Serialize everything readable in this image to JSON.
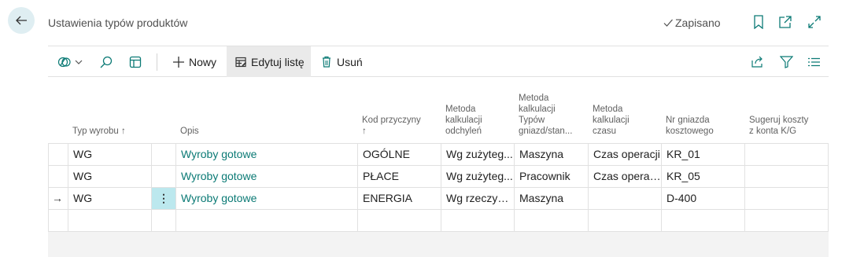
{
  "page": {
    "title": "Ustawienia typów produktów",
    "saved_label": "Zapisano"
  },
  "toolbar": {
    "new_label": "Nowy",
    "edit_list_label": "Edytuj listę",
    "delete_label": "Usuń"
  },
  "columns": {
    "product_type": "Typ wyrobu",
    "product_type_sort": "↑",
    "description": "Opis",
    "reason_code_line1": "Kod przyczyny",
    "reason_code_line2": "↑",
    "variance_line1": "Metoda",
    "variance_line2": "kalkulacji",
    "variance_line3": "odchyleń",
    "wc_line1": "Metoda",
    "wc_line2": "kalkulacji",
    "wc_line3": "Typów",
    "wc_line4": "gniazd/stan...",
    "time_line1": "Metoda",
    "time_line2": "kalkulacji",
    "time_line3": "czasu",
    "center_line1": "Nr gniazda",
    "center_line2": "kosztowego",
    "suggest_line1": "Sugeruj koszty",
    "suggest_line2": "z konta K/G"
  },
  "rows": [
    {
      "type": "WG",
      "desc": "Wyroby gotowe",
      "code": "OGÓLNE",
      "variance": "Wg zużyteg...",
      "wc": "Maszyna",
      "time": "Czas operacji",
      "center": "KR_01",
      "suggest": ""
    },
    {
      "type": "WG",
      "desc": "Wyroby gotowe",
      "code": "PŁACE",
      "variance": "Wg zużyteg...",
      "wc": "Pracownik",
      "time": "Czas operac...",
      "center": "KR_05",
      "suggest": ""
    },
    {
      "type": "WG",
      "desc": "Wyroby gotowe",
      "code": "ENERGIA",
      "variance": "Wg rzeczyw...",
      "wc": "Maszyna",
      "time": "",
      "center": "D-400",
      "suggest": ""
    }
  ],
  "current_row_marker": "→",
  "row_menu_glyph": "⋮"
}
